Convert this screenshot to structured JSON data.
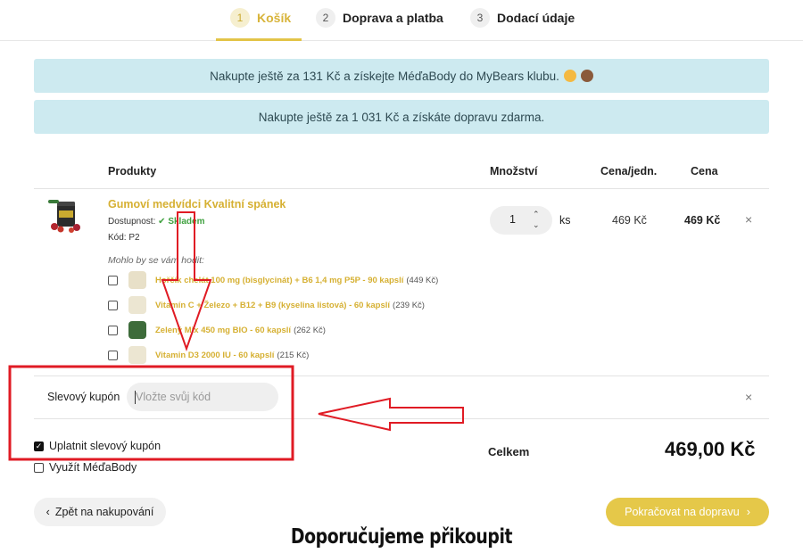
{
  "steps": [
    {
      "num": "1",
      "label": "Košík"
    },
    {
      "num": "2",
      "label": "Doprava a platba"
    },
    {
      "num": "3",
      "label": "Dodací údaje"
    }
  ],
  "banners": {
    "club": "Nakupte ještě za 131 Kč a získejte MéďaBody do MyBears klubu.",
    "shipping": "Nakupte ještě za 1 031 Kč a získáte dopravu zdarma."
  },
  "table": {
    "col_products": "Produkty",
    "col_quantity": "Množství",
    "col_unit_price": "Cena/jedn.",
    "col_price": "Cena"
  },
  "product": {
    "name": "Gumoví medvídci Kvalitní spánek",
    "availability_label": "Dostupnost:",
    "availability_value": "Skladem",
    "code_label": "Kód:",
    "code_value": "P2",
    "quantity": "1",
    "unit": "ks",
    "unit_price": "469 Kč",
    "price": "469 Kč"
  },
  "recommendations": {
    "heading": "Mohlo by se vám hodit:",
    "items": [
      {
        "name": "Hořčík chelát 100 mg (bisglycinát) + B6 1,4 mg P5P - 90 kapslí",
        "price": "(449 Kč)"
      },
      {
        "name": "Vitamín C + Železo + B12 + B9 (kyselina listová) - 60 kapslí",
        "price": "(239 Kč)"
      },
      {
        "name": "Zelený Mix 450 mg BIO - 60 kapslí",
        "price": "(262 Kč)"
      },
      {
        "name": "Vitamin D3 2000 IU - 60 kapslí",
        "price": "(215 Kč)"
      }
    ]
  },
  "coupon": {
    "label": "Slevový kupón",
    "placeholder": "Vložte svůj kód",
    "apply_label": "Uplatnit slevový kupón",
    "apply_checked": true,
    "use_points_label": "Využít MéďaBody",
    "use_points_checked": false
  },
  "summary": {
    "label": "Celkem",
    "value": "469,00 Kč"
  },
  "buttons": {
    "back": "Zpět na nakupování",
    "next": "Pokračovat na dopravu"
  },
  "recommend_heading": "Doporučujeme přikoupit",
  "icons": {
    "remove": "close-icon",
    "check": "checkmark-icon",
    "back": "chevron-left-icon",
    "next": "chevron-right-icon"
  },
  "colors": {
    "accent": "#e5c849",
    "product_link": "#d6b032",
    "banner_bg": "#cdeaf0",
    "stock_green": "#3fa13f",
    "annotation_red": "#e01b24"
  }
}
